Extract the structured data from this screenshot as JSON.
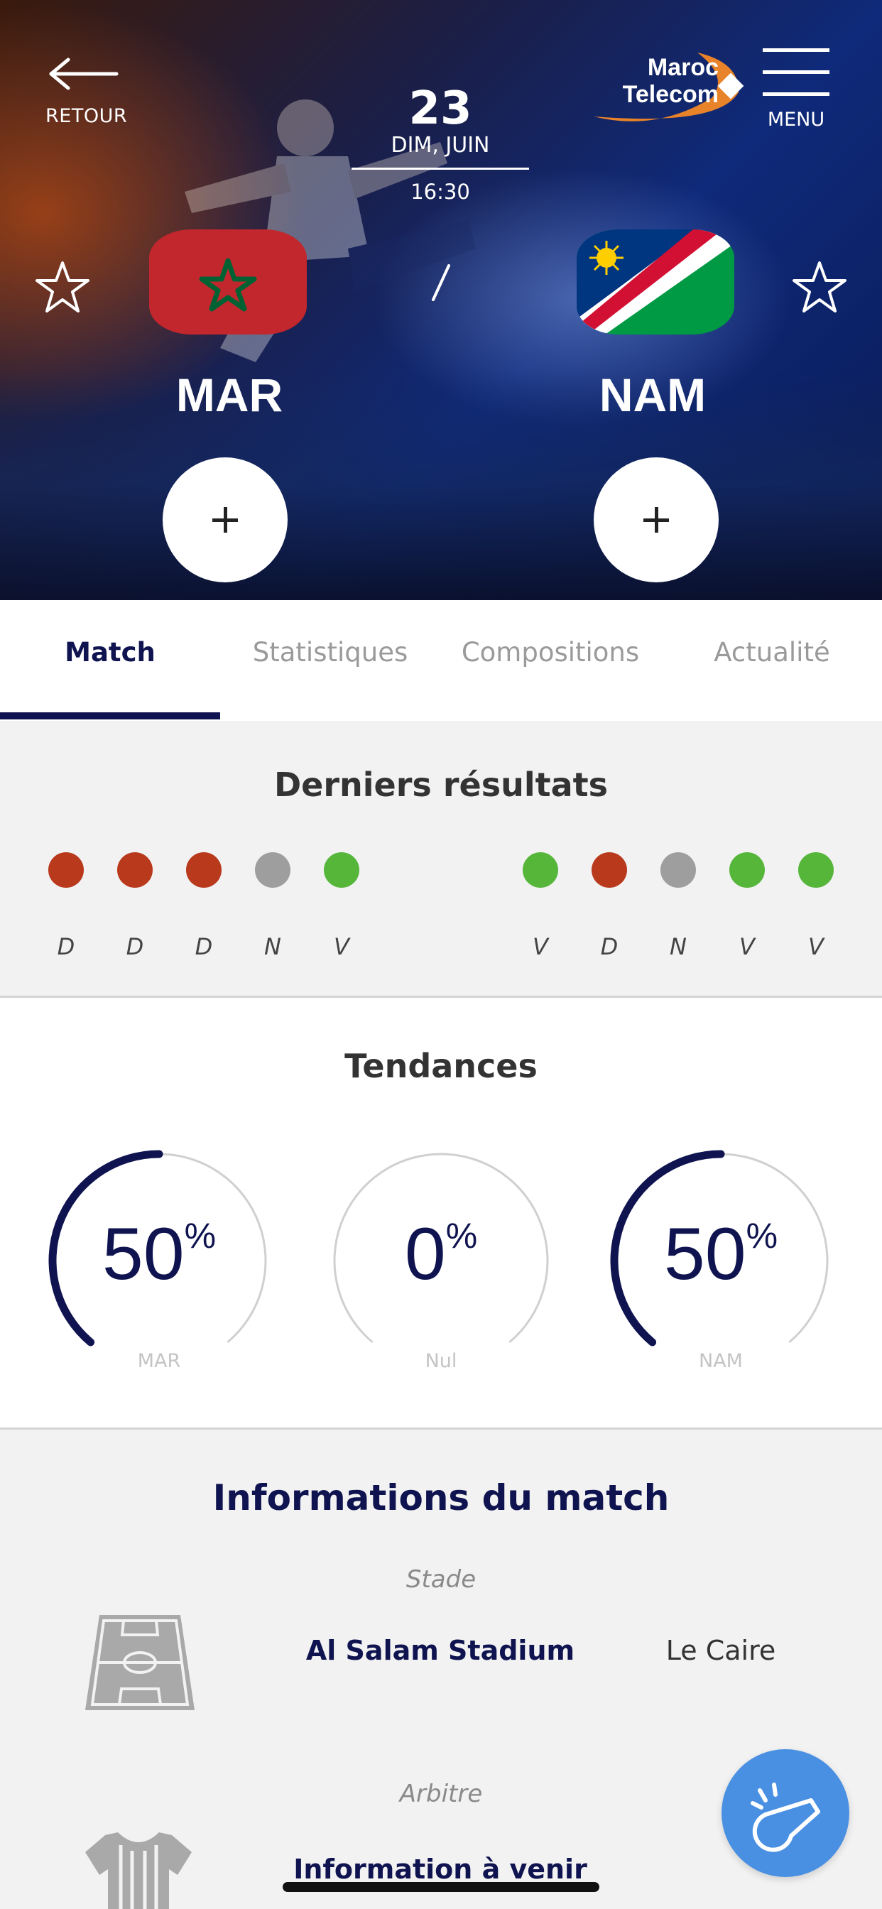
{
  "header": {
    "back_label": "RETOUR",
    "menu_label": "MENU",
    "brand_line1": "Maroc",
    "brand_line2": "Telecom"
  },
  "match": {
    "day": "23",
    "month": "DIM, JUIN",
    "time": "16:30",
    "score_separator": "/",
    "home": {
      "code": "MAR",
      "flag_colors": [
        "#c1272d",
        "#006233"
      ]
    },
    "away": {
      "code": "NAM",
      "flag_colors": [
        "#003580",
        "#d21034",
        "#009a44",
        "#ffce00"
      ]
    }
  },
  "tabs": [
    {
      "label": "Match",
      "active": true
    },
    {
      "label": "Statistiques",
      "active": false
    },
    {
      "label": "Compositions",
      "active": false
    },
    {
      "label": "Actualité",
      "active": false
    }
  ],
  "results": {
    "title": "Derniers résultats",
    "home": [
      "D",
      "D",
      "D",
      "N",
      "V"
    ],
    "away": [
      "V",
      "D",
      "N",
      "V",
      "V"
    ],
    "colors": {
      "D": "#b8391c",
      "N": "#9e9e9e",
      "V": "#55b63a"
    }
  },
  "trends": {
    "title": "Tendances",
    "items": [
      {
        "value": "50",
        "unit": "%",
        "label": "MAR",
        "fraction": 0.5
      },
      {
        "value": "0",
        "unit": "%",
        "label": "Nul",
        "fraction": 0
      },
      {
        "value": "50",
        "unit": "%",
        "label": "NAM",
        "fraction": 0.5
      }
    ]
  },
  "info": {
    "title": "Informations du match",
    "stadium_label": "Stade",
    "stadium_name": "Al Salam Stadium",
    "city": "Le Caire",
    "referee_label": "Arbitre",
    "referee_name": "Information à venir"
  },
  "colors": {
    "navy": "#0f1450",
    "whistle_button": "#4a90e2"
  }
}
